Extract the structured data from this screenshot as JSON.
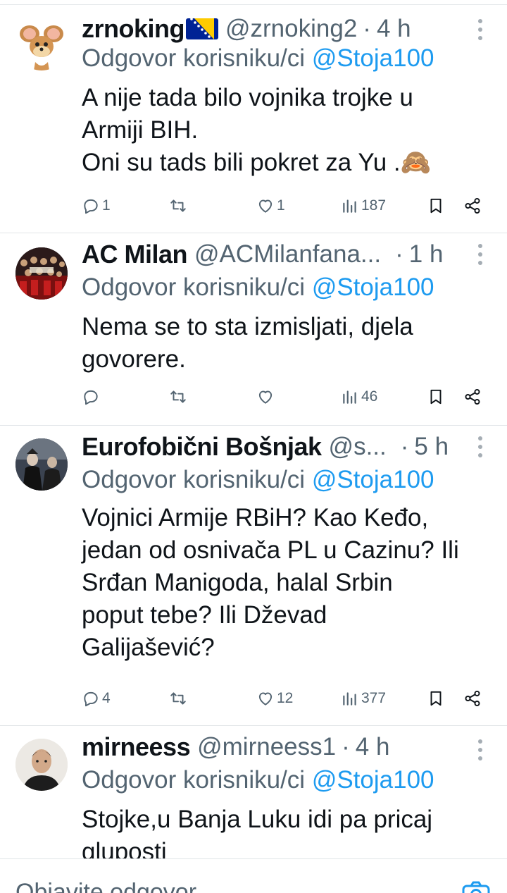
{
  "tweets": [
    {
      "name": "zrnoking",
      "handle": "@zrnoking2",
      "time": "4 h",
      "reply_prefix": "Odgovor korisniku/ci",
      "reply_mention": "@Stoja100",
      "body": [
        "A nije tada bilo vojnika trojke u",
        "Armiji BIH.",
        "Oni su tads bili pokret za Yu .🙈"
      ],
      "replies": "1",
      "reposts": "",
      "likes": "1",
      "views": "187"
    },
    {
      "name": "AC Milan",
      "handle": "@ACMilanfana...",
      "time": "1 h",
      "reply_prefix": "Odgovor korisniku/ci",
      "reply_mention": "@Stoja100",
      "body": [
        "Nema se to sta izmisljati, djela",
        "govorere."
      ],
      "replies": "",
      "reposts": "",
      "likes": "",
      "views": "46"
    },
    {
      "name": "Eurofobični Bošnjak",
      "handle": "@s...",
      "time": "5 h",
      "reply_prefix": "Odgovor korisniku/ci",
      "reply_mention": "@Stoja100",
      "body": [
        "Vojnici Armije RBiH? Kao Keđo,",
        "jedan od osnivača PL u Cazinu? Ili",
        "Srđan Manigoda, halal Srbin",
        "poput tebe? Ili Dževad",
        "Galijašević?"
      ],
      "replies": "4",
      "reposts": "",
      "likes": "12",
      "views": "377"
    },
    {
      "name": "mirneess",
      "handle": "@mirneess1",
      "time": "4 h",
      "reply_prefix": "Odgovor korisniku/ci",
      "reply_mention": "@Stoja100",
      "body": [
        "Stojke,u Banja Luku idi pa pricaj",
        "gluposti"
      ]
    }
  ],
  "composer": {
    "placeholder": "Objavite odgovor"
  },
  "colors": {
    "accent": "#1d9bf0",
    "muted": "#536471",
    "text": "#0f1419",
    "divider": "#e1e5e8"
  },
  "icons": [
    "reply-icon",
    "repost-icon",
    "like-icon",
    "views-icon",
    "bookmark-icon",
    "share-icon",
    "more-icon",
    "camera-icon"
  ]
}
